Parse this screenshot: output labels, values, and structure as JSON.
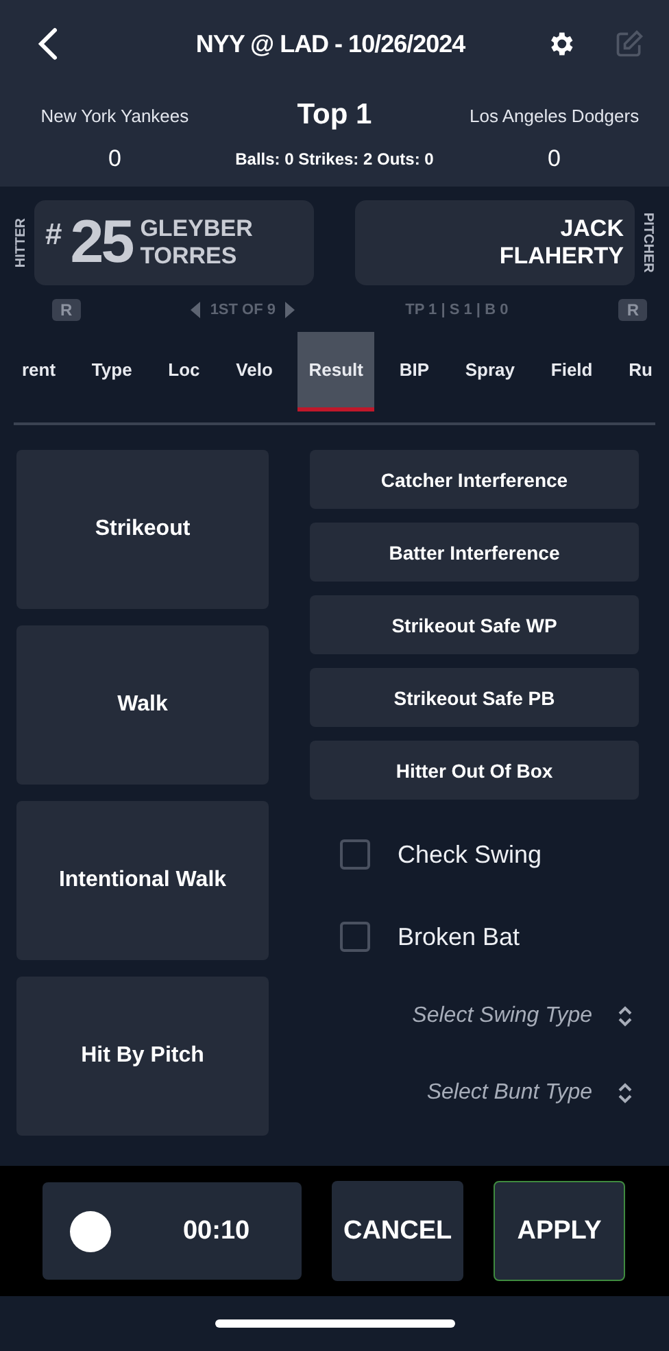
{
  "header": {
    "title": "NYY @ LAD - 10/26/2024"
  },
  "scoreboard": {
    "away_team": "New York Yankees",
    "away_score": "0",
    "inning": "Top 1",
    "count": "Balls: 0 Strikes: 2 Outs: 0",
    "home_team": "Los Angeles Dodgers",
    "home_score": "0"
  },
  "hitter": {
    "label": "HITTER",
    "number_sign": "#",
    "number": "25",
    "first_name": "GLEYBER",
    "last_name": "TORRES",
    "hand": "R",
    "order": "1ST OF 9"
  },
  "pitcher": {
    "label": "PITCHER",
    "first_name": "JACK",
    "last_name": "FLAHERTY",
    "hand": "R",
    "stats": "TP 1 | S 1 | B 0"
  },
  "tabs": [
    {
      "label": "rent",
      "selected": false
    },
    {
      "label": "Type",
      "selected": false
    },
    {
      "label": "Loc",
      "selected": false
    },
    {
      "label": "Velo",
      "selected": false
    },
    {
      "label": "Result",
      "selected": true
    },
    {
      "label": "BIP",
      "selected": false
    },
    {
      "label": "Spray",
      "selected": false
    },
    {
      "label": "Field",
      "selected": false
    },
    {
      "label": "Ru",
      "selected": false
    }
  ],
  "result_buttons": [
    "Strikeout",
    "Walk",
    "Intentional Walk",
    "Hit By Pitch"
  ],
  "other_buttons": [
    "Catcher Interference",
    "Batter Interference",
    "Strikeout Safe WP",
    "Strikeout Safe PB",
    "Hitter Out Of Box"
  ],
  "checkboxes": [
    {
      "label": "Check Swing",
      "checked": false
    },
    {
      "label": "Broken Bat",
      "checked": false
    }
  ],
  "selects": [
    {
      "placeholder": "Select Swing Type"
    },
    {
      "placeholder": "Select Bunt Type"
    }
  ],
  "footer": {
    "timer": "00:10",
    "cancel": "CANCEL",
    "apply": "APPLY"
  }
}
